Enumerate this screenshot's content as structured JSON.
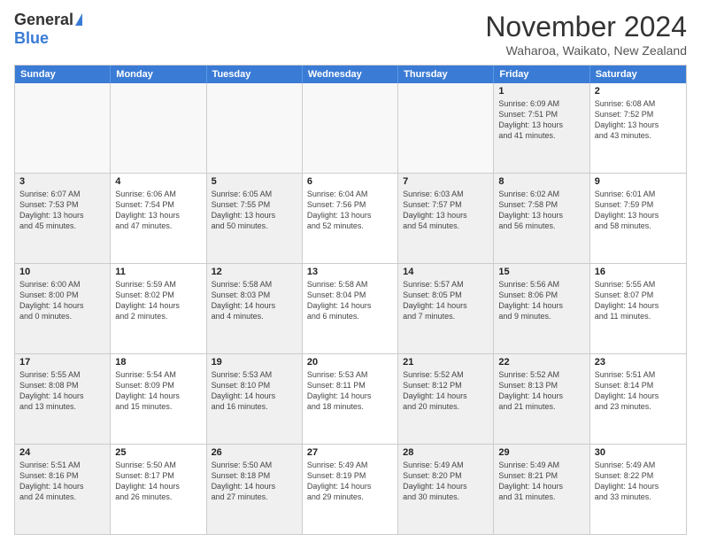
{
  "logo": {
    "general": "General",
    "blue": "Blue"
  },
  "title": "November 2024",
  "subtitle": "Waharoa, Waikato, New Zealand",
  "header_days": [
    "Sunday",
    "Monday",
    "Tuesday",
    "Wednesday",
    "Thursday",
    "Friday",
    "Saturday"
  ],
  "rows": [
    [
      {
        "day": "",
        "info": "",
        "empty": true
      },
      {
        "day": "",
        "info": "",
        "empty": true
      },
      {
        "day": "",
        "info": "",
        "empty": true
      },
      {
        "day": "",
        "info": "",
        "empty": true
      },
      {
        "day": "",
        "info": "",
        "empty": true
      },
      {
        "day": "1",
        "info": "Sunrise: 6:09 AM\nSunset: 7:51 PM\nDaylight: 13 hours\nand 41 minutes.",
        "shaded": true
      },
      {
        "day": "2",
        "info": "Sunrise: 6:08 AM\nSunset: 7:52 PM\nDaylight: 13 hours\nand 43 minutes."
      }
    ],
    [
      {
        "day": "3",
        "info": "Sunrise: 6:07 AM\nSunset: 7:53 PM\nDaylight: 13 hours\nand 45 minutes.",
        "shaded": true
      },
      {
        "day": "4",
        "info": "Sunrise: 6:06 AM\nSunset: 7:54 PM\nDaylight: 13 hours\nand 47 minutes."
      },
      {
        "day": "5",
        "info": "Sunrise: 6:05 AM\nSunset: 7:55 PM\nDaylight: 13 hours\nand 50 minutes.",
        "shaded": true
      },
      {
        "day": "6",
        "info": "Sunrise: 6:04 AM\nSunset: 7:56 PM\nDaylight: 13 hours\nand 52 minutes."
      },
      {
        "day": "7",
        "info": "Sunrise: 6:03 AM\nSunset: 7:57 PM\nDaylight: 13 hours\nand 54 minutes.",
        "shaded": true
      },
      {
        "day": "8",
        "info": "Sunrise: 6:02 AM\nSunset: 7:58 PM\nDaylight: 13 hours\nand 56 minutes.",
        "shaded": true
      },
      {
        "day": "9",
        "info": "Sunrise: 6:01 AM\nSunset: 7:59 PM\nDaylight: 13 hours\nand 58 minutes."
      }
    ],
    [
      {
        "day": "10",
        "info": "Sunrise: 6:00 AM\nSunset: 8:00 PM\nDaylight: 14 hours\nand 0 minutes.",
        "shaded": true
      },
      {
        "day": "11",
        "info": "Sunrise: 5:59 AM\nSunset: 8:02 PM\nDaylight: 14 hours\nand 2 minutes."
      },
      {
        "day": "12",
        "info": "Sunrise: 5:58 AM\nSunset: 8:03 PM\nDaylight: 14 hours\nand 4 minutes.",
        "shaded": true
      },
      {
        "day": "13",
        "info": "Sunrise: 5:58 AM\nSunset: 8:04 PM\nDaylight: 14 hours\nand 6 minutes."
      },
      {
        "day": "14",
        "info": "Sunrise: 5:57 AM\nSunset: 8:05 PM\nDaylight: 14 hours\nand 7 minutes.",
        "shaded": true
      },
      {
        "day": "15",
        "info": "Sunrise: 5:56 AM\nSunset: 8:06 PM\nDaylight: 14 hours\nand 9 minutes.",
        "shaded": true
      },
      {
        "day": "16",
        "info": "Sunrise: 5:55 AM\nSunset: 8:07 PM\nDaylight: 14 hours\nand 11 minutes."
      }
    ],
    [
      {
        "day": "17",
        "info": "Sunrise: 5:55 AM\nSunset: 8:08 PM\nDaylight: 14 hours\nand 13 minutes.",
        "shaded": true
      },
      {
        "day": "18",
        "info": "Sunrise: 5:54 AM\nSunset: 8:09 PM\nDaylight: 14 hours\nand 15 minutes."
      },
      {
        "day": "19",
        "info": "Sunrise: 5:53 AM\nSunset: 8:10 PM\nDaylight: 14 hours\nand 16 minutes.",
        "shaded": true
      },
      {
        "day": "20",
        "info": "Sunrise: 5:53 AM\nSunset: 8:11 PM\nDaylight: 14 hours\nand 18 minutes."
      },
      {
        "day": "21",
        "info": "Sunrise: 5:52 AM\nSunset: 8:12 PM\nDaylight: 14 hours\nand 20 minutes.",
        "shaded": true
      },
      {
        "day": "22",
        "info": "Sunrise: 5:52 AM\nSunset: 8:13 PM\nDaylight: 14 hours\nand 21 minutes.",
        "shaded": true
      },
      {
        "day": "23",
        "info": "Sunrise: 5:51 AM\nSunset: 8:14 PM\nDaylight: 14 hours\nand 23 minutes."
      }
    ],
    [
      {
        "day": "24",
        "info": "Sunrise: 5:51 AM\nSunset: 8:16 PM\nDaylight: 14 hours\nand 24 minutes.",
        "shaded": true
      },
      {
        "day": "25",
        "info": "Sunrise: 5:50 AM\nSunset: 8:17 PM\nDaylight: 14 hours\nand 26 minutes."
      },
      {
        "day": "26",
        "info": "Sunrise: 5:50 AM\nSunset: 8:18 PM\nDaylight: 14 hours\nand 27 minutes.",
        "shaded": true
      },
      {
        "day": "27",
        "info": "Sunrise: 5:49 AM\nSunset: 8:19 PM\nDaylight: 14 hours\nand 29 minutes."
      },
      {
        "day": "28",
        "info": "Sunrise: 5:49 AM\nSunset: 8:20 PM\nDaylight: 14 hours\nand 30 minutes.",
        "shaded": true
      },
      {
        "day": "29",
        "info": "Sunrise: 5:49 AM\nSunset: 8:21 PM\nDaylight: 14 hours\nand 31 minutes.",
        "shaded": true
      },
      {
        "day": "30",
        "info": "Sunrise: 5:49 AM\nSunset: 8:22 PM\nDaylight: 14 hours\nand 33 minutes."
      }
    ]
  ]
}
